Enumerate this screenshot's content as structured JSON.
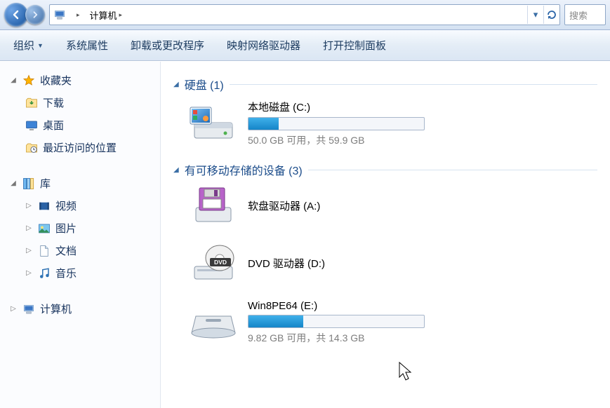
{
  "address": {
    "root_label": "计算机",
    "dropdown_glyph": "▾",
    "refresh_glyph": "↻"
  },
  "search": {
    "placeholder": "搜索"
  },
  "toolbar": {
    "organize": "组织",
    "system_props": "系统属性",
    "uninstall": "卸载或更改程序",
    "mapnet": "映射网络驱动器",
    "controlpanel": "打开控制面板"
  },
  "sidebar": {
    "favorites": {
      "label": "收藏夹"
    },
    "downloads": {
      "label": "下载"
    },
    "desktop": {
      "label": "桌面"
    },
    "recent": {
      "label": "最近访问的位置"
    },
    "libraries": {
      "label": "库"
    },
    "videos": {
      "label": "视频"
    },
    "pictures": {
      "label": "图片"
    },
    "documents": {
      "label": "文档"
    },
    "music": {
      "label": "音乐"
    },
    "computer": {
      "label": "计算机"
    }
  },
  "groups": {
    "hdd": {
      "header": "硬盘 (1)"
    },
    "removable": {
      "header": "有可移动存储的设备 (3)"
    }
  },
  "drives": {
    "c": {
      "name": "本地磁盘 (C:)",
      "usage": "50.0 GB 可用，共 59.9 GB",
      "used_pct": 17
    },
    "a": {
      "name": "软盘驱动器 (A:)"
    },
    "d": {
      "name": "DVD 驱动器 (D:)"
    },
    "e": {
      "name": "Win8PE64 (E:)",
      "usage": "9.82 GB 可用，共 14.3 GB",
      "used_pct": 31
    }
  }
}
